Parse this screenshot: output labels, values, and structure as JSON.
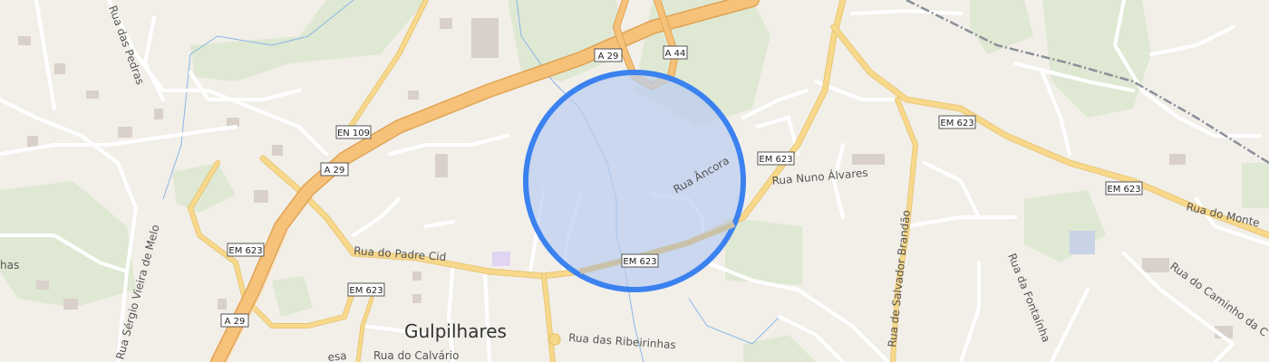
{
  "map": {
    "place": "Gulpilhares",
    "shields": {
      "a29_top": "A 29",
      "a29_mid": "A 29",
      "a29_bottom": "A 29",
      "a44": "A 44",
      "en109": "EN 109",
      "em623_a": "EM 623",
      "em623_b": "EM 623",
      "em623_c": "EM 623",
      "em623_d": "EM 623",
      "em623_e": "EM 623",
      "em623_f": "EM 623"
    },
    "streets": {
      "rua_das_pedras": "Rua das Pedras",
      "rua_sergio": "Rua Sérgio Vieira de Melo",
      "rua_padre_cid": "Rua do Padre Cid",
      "rua_ancora": "Rua Âncora",
      "rua_nuno": "Rua Nuno Álvares",
      "rua_salvador": "Rua de Salvador Brandão",
      "rua_fontainha": "Rua da Fontaínha",
      "rua_caminho": "Rua do Caminho da C",
      "rua_monte": "Rua do Monte",
      "rua_ribeirinhas": "Rua das Ribeirinhas",
      "rua_calvario": "Rua do Calvário",
      "rua_esa": "esa",
      "rua_has": "has"
    },
    "colors": {
      "background": "#f2efe9",
      "motorway": "#f6c27a",
      "motorway_casing": "#e0a354",
      "secondary": "#f8d88a",
      "minor": "#ffffff",
      "green": "#dfe8d2",
      "circle_fill": "#b9cdf0",
      "circle_stroke": "#3b82f0",
      "railway": "#8a8f99",
      "water": "#8bb6e8"
    }
  }
}
